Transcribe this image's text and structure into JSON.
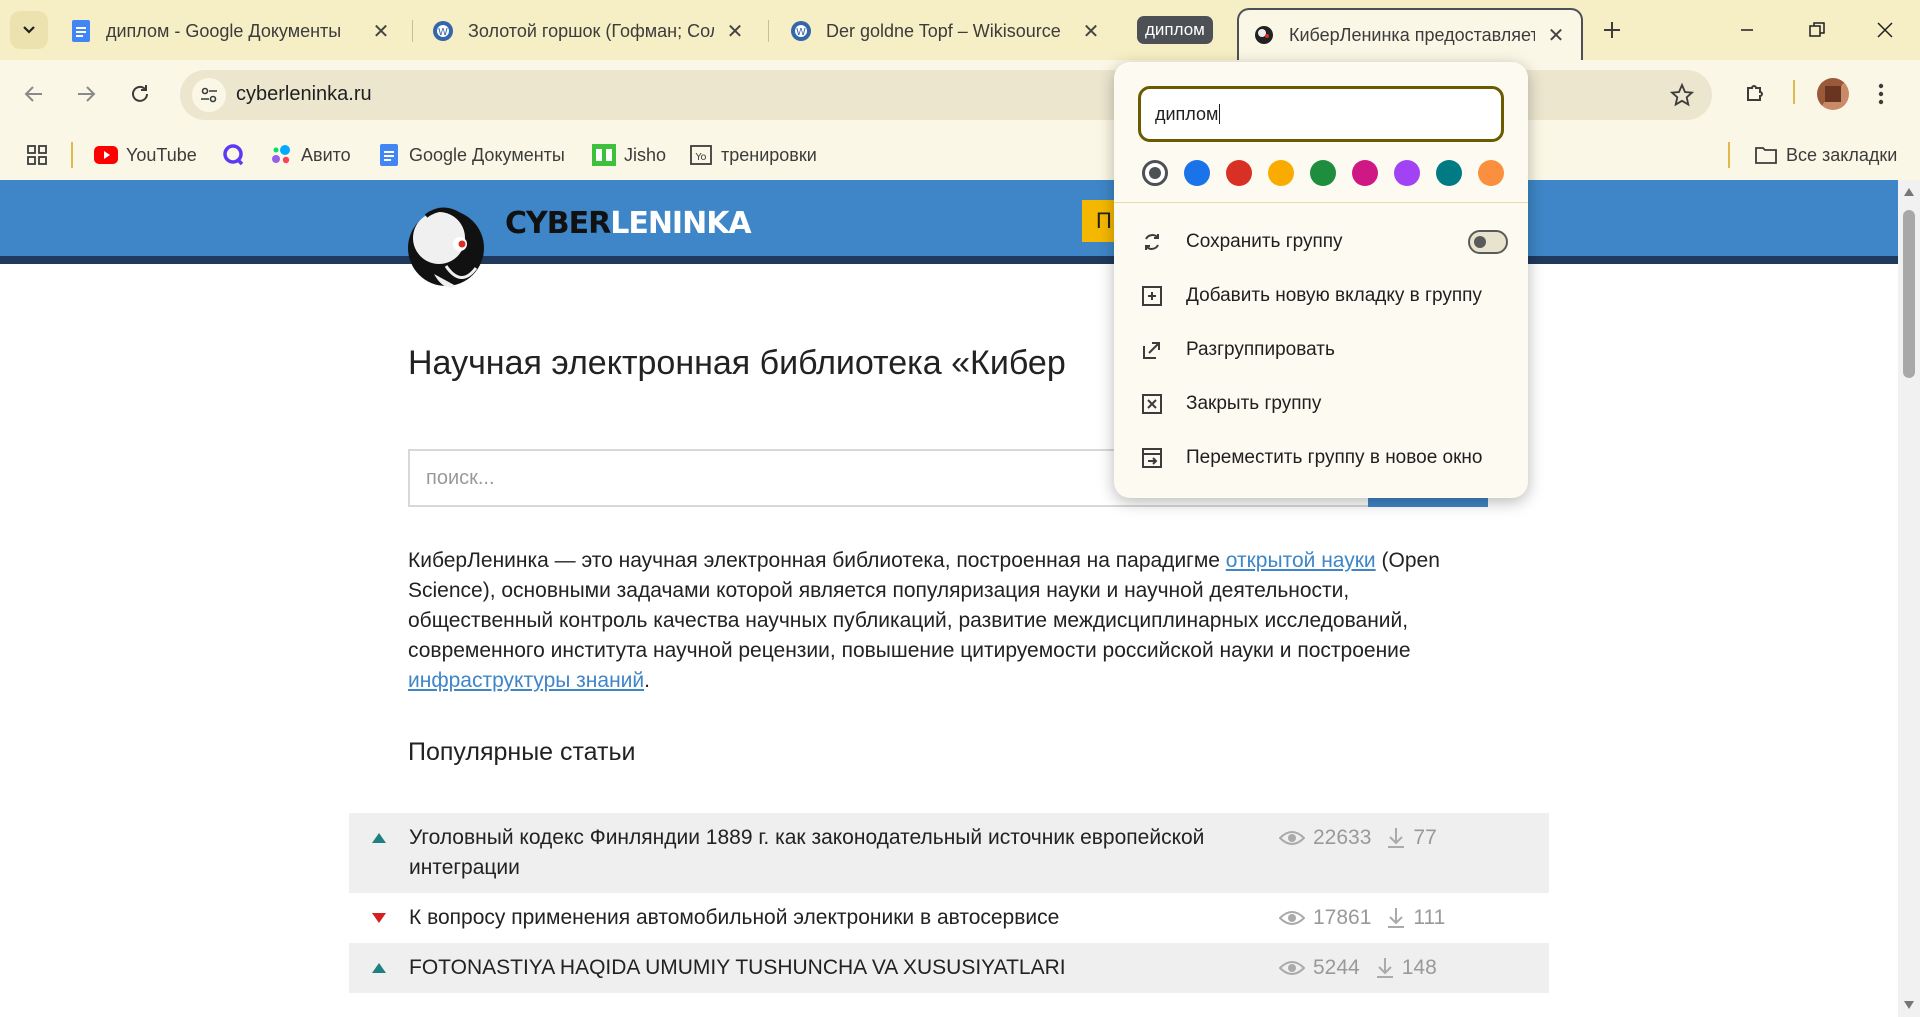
{
  "tabs": [
    {
      "title": "диплом - Google Документы",
      "favicon": "google-docs-icon"
    },
    {
      "title": "Золотой горшок (Гофман; Сол",
      "favicon": "wikisource-icon"
    },
    {
      "title": "Der goldne Topf – Wikisource",
      "favicon": "wikisource-icon"
    },
    {
      "title": "КиберЛенинка предоставляет",
      "favicon": "cyberleninka-icon"
    }
  ],
  "tab_group": {
    "label": "диплом"
  },
  "omnibox": {
    "url": "cyberleninka.ru"
  },
  "bookmarks": {
    "items": [
      {
        "label": "YouTube",
        "icon": "youtube-icon"
      },
      {
        "label": "",
        "icon": "q-icon"
      },
      {
        "label": "Авито",
        "icon": "avito-icon"
      },
      {
        "label": "Google Документы",
        "icon": "google-docs-icon"
      },
      {
        "label": "Jisho",
        "icon": "jisho-icon"
      },
      {
        "label": "тренировки",
        "icon": "yo-icon"
      }
    ],
    "all_label": "Все закладки"
  },
  "site": {
    "brand_a": "CYBER",
    "brand_b": "LENINKA",
    "yellow_btn": "П",
    "title": "Научная электронная библиотека «Кибер",
    "search_placeholder": "поиск...",
    "intro_1": "КиберЛенинка — это научная электронная библиотека, построенная на парадигме ",
    "intro_link_1": "открытой науки",
    "intro_2": " (Open Science), основными задачами которой является популяризация науки и научной деятельности, общественный контроль качества научных публикаций, развитие междисциплинарных исследований, современного института научной рецензии, повышение цитируемости российской науки и построение ",
    "intro_link_2": "инфраструктуры знаний",
    "intro_3": ".",
    "popular_title": "Популярные статьи",
    "articles": [
      {
        "title": "Уголовный кодекс Финляндии 1889 г. как законодательный источник европейской интеграции",
        "views": "22633",
        "downloads": "77",
        "trend": "up"
      },
      {
        "title": "К вопросу применения автомобильной электроники в автосервисе",
        "views": "17861",
        "downloads": "111",
        "trend": "down"
      },
      {
        "title": "FOTONASTIYA HAQIDA UMUMIY TUSHUNCHA VA XUSUSIYATLARI",
        "views": "5244",
        "downloads": "148",
        "trend": "up"
      }
    ]
  },
  "group_popup": {
    "name_value": "диплом",
    "colors": [
      "#4d5156",
      "#1a73e8",
      "#d93025",
      "#f9ab00",
      "#1e8e3e",
      "#d01884",
      "#a142f4",
      "#007b83",
      "#fa903e"
    ],
    "selected_color": "#4d5156",
    "save_group": "Сохранить группу",
    "add_tab": "Добавить новую вкладку в группу",
    "ungroup": "Разгруппировать",
    "close_group": "Закрыть группу",
    "move_group": "Переместить группу в новое окно"
  }
}
